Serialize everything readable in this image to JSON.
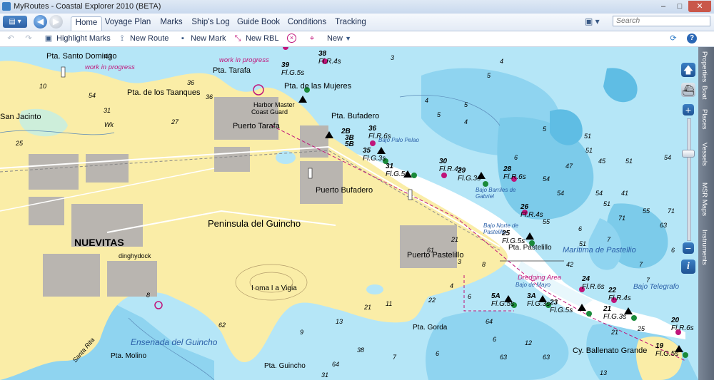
{
  "window": {
    "title": "MyRoutes - Coastal Explorer 2010 (BETA)",
    "minimize": "–",
    "maximize": "□",
    "close": "✕"
  },
  "app_menu_icon": "menu-icon",
  "tabs": [
    {
      "label": "Home",
      "active": true
    },
    {
      "label": "Voyage Plan"
    },
    {
      "label": "Marks"
    },
    {
      "label": "Ship's Log"
    },
    {
      "label": "Guide Book"
    },
    {
      "label": "Conditions"
    },
    {
      "label": "Tracking"
    }
  ],
  "search": {
    "placeholder": "Search"
  },
  "toolbar": {
    "undo_icon": "undo-icon",
    "redo_icon": "redo-icon",
    "highlight_marks": "Highlight Marks",
    "new_route": "New Route",
    "new_mark": "New Mark",
    "new_rbl": "New RBL",
    "new": "New",
    "refresh_icon": "refresh-icon",
    "help_icon": "help-icon"
  },
  "side_tabs": [
    "Properties",
    "Boat",
    "Places",
    "Vessels",
    "MSR Maps",
    "Instruments"
  ],
  "map": {
    "places": {
      "peninsula": "Peninsula del Guincho",
      "nuevitas": "NUEVITAS",
      "san_jacinto": "San Jacinto",
      "pta_santo_domingo": "Pta. Santo Domingo",
      "pta_taanques": "Pta. de los Taanques",
      "pta_tarafa": "Pta. Tarafa",
      "pta_mujeres": "Pta. de las Mujeres",
      "harbor_master": "Harbor Master",
      "coast_guard": "Coast Guard",
      "puerto_tarafa": "Puerto Tarafa",
      "pta_bufadero": "Pta. Bufadero",
      "puerto_bufadero": "Puerto Bufadero",
      "puerto_pastelillo": "Puerto Pastelillo",
      "pta_pastelillo": "Pta. Pastelillo",
      "dinghydock": "dinghydock",
      "loma_vigia": "I oma I a Vigia",
      "pta_gorda": "Pta. Gorda",
      "pta_molino": "Pta. Molino",
      "pta_guincho": "Pta. Guincho",
      "cy_ballenato": "Cy. Ballenato Grande"
    },
    "water_names": {
      "ensenada": "Ensenada del Guincho",
      "maritima": "Marítima de Pastellio",
      "bajo_telegrafo": "Bajo Telegrafo",
      "bajo_palo_pelao": "Bajo Palo Pelao",
      "bajo_barrilles": "Bajo Barriles de Gabriel",
      "bajo_norte": "Bajo Norte de Pastelillo",
      "bajo_mayo": "Bajo de Mayo"
    },
    "notes": {
      "work1": "work in progress",
      "work2": "work in progress",
      "dredging": "Dredging Area",
      "wk": "Wk",
      "santa_rita": "Santa Rita"
    },
    "beacons": [
      {
        "num": "38",
        "light": "Fl.R.4s"
      },
      {
        "num": "39",
        "light": "Fl.G.5s"
      },
      {
        "num": "36",
        "light": "Fl.R.6s"
      },
      {
        "num": "2B",
        "light": ""
      },
      {
        "num": "3B",
        "light": ""
      },
      {
        "num": "5B",
        "light": ""
      },
      {
        "num": "35",
        "light": "Fl.G.3s"
      },
      {
        "num": "30",
        "light": "Fl.R.4s"
      },
      {
        "num": "31",
        "light": "Fl.G.5s"
      },
      {
        "num": "29",
        "light": "Fl.G.3s"
      },
      {
        "num": "28",
        "light": "Fl.R.6s"
      },
      {
        "num": "26",
        "light": "Fl.R.4s"
      },
      {
        "num": "25",
        "light": "Fl.G.5s"
      },
      {
        "num": "24",
        "light": "Fl.R.6s"
      },
      {
        "num": "22",
        "light": "Fl.R.4s"
      },
      {
        "num": "21",
        "light": "Fl.G.3s"
      },
      {
        "num": "23",
        "light": "Fl.G.5s"
      },
      {
        "num": "5A",
        "light": "Fl.G.5s"
      },
      {
        "num": "3A",
        "light": "Fl.G.3s"
      },
      {
        "num": "20",
        "light": "Fl.R.6s"
      },
      {
        "num": "19",
        "light": "Fl.G.5s"
      }
    ],
    "depths": [
      "43",
      "36",
      "54",
      "36",
      "27",
      "31",
      "3",
      "4",
      "5",
      "4",
      "5",
      "4",
      "5",
      "51",
      "51",
      "5",
      "51",
      "45",
      "47",
      "54",
      "41",
      "54",
      "51",
      "55",
      "71",
      "71",
      "63",
      "6",
      "7",
      "7",
      "7",
      "51",
      "55",
      "54",
      "6",
      "54",
      "6",
      "42",
      "4",
      "6",
      "61",
      "64",
      "6",
      "63",
      "21",
      "3",
      "8",
      "12",
      "63",
      "13",
      "25",
      "21",
      "22",
      "11",
      "21",
      "13",
      "38",
      "7",
      "6",
      "64",
      "9",
      "62",
      "8",
      "10",
      "25",
      "31"
    ]
  }
}
